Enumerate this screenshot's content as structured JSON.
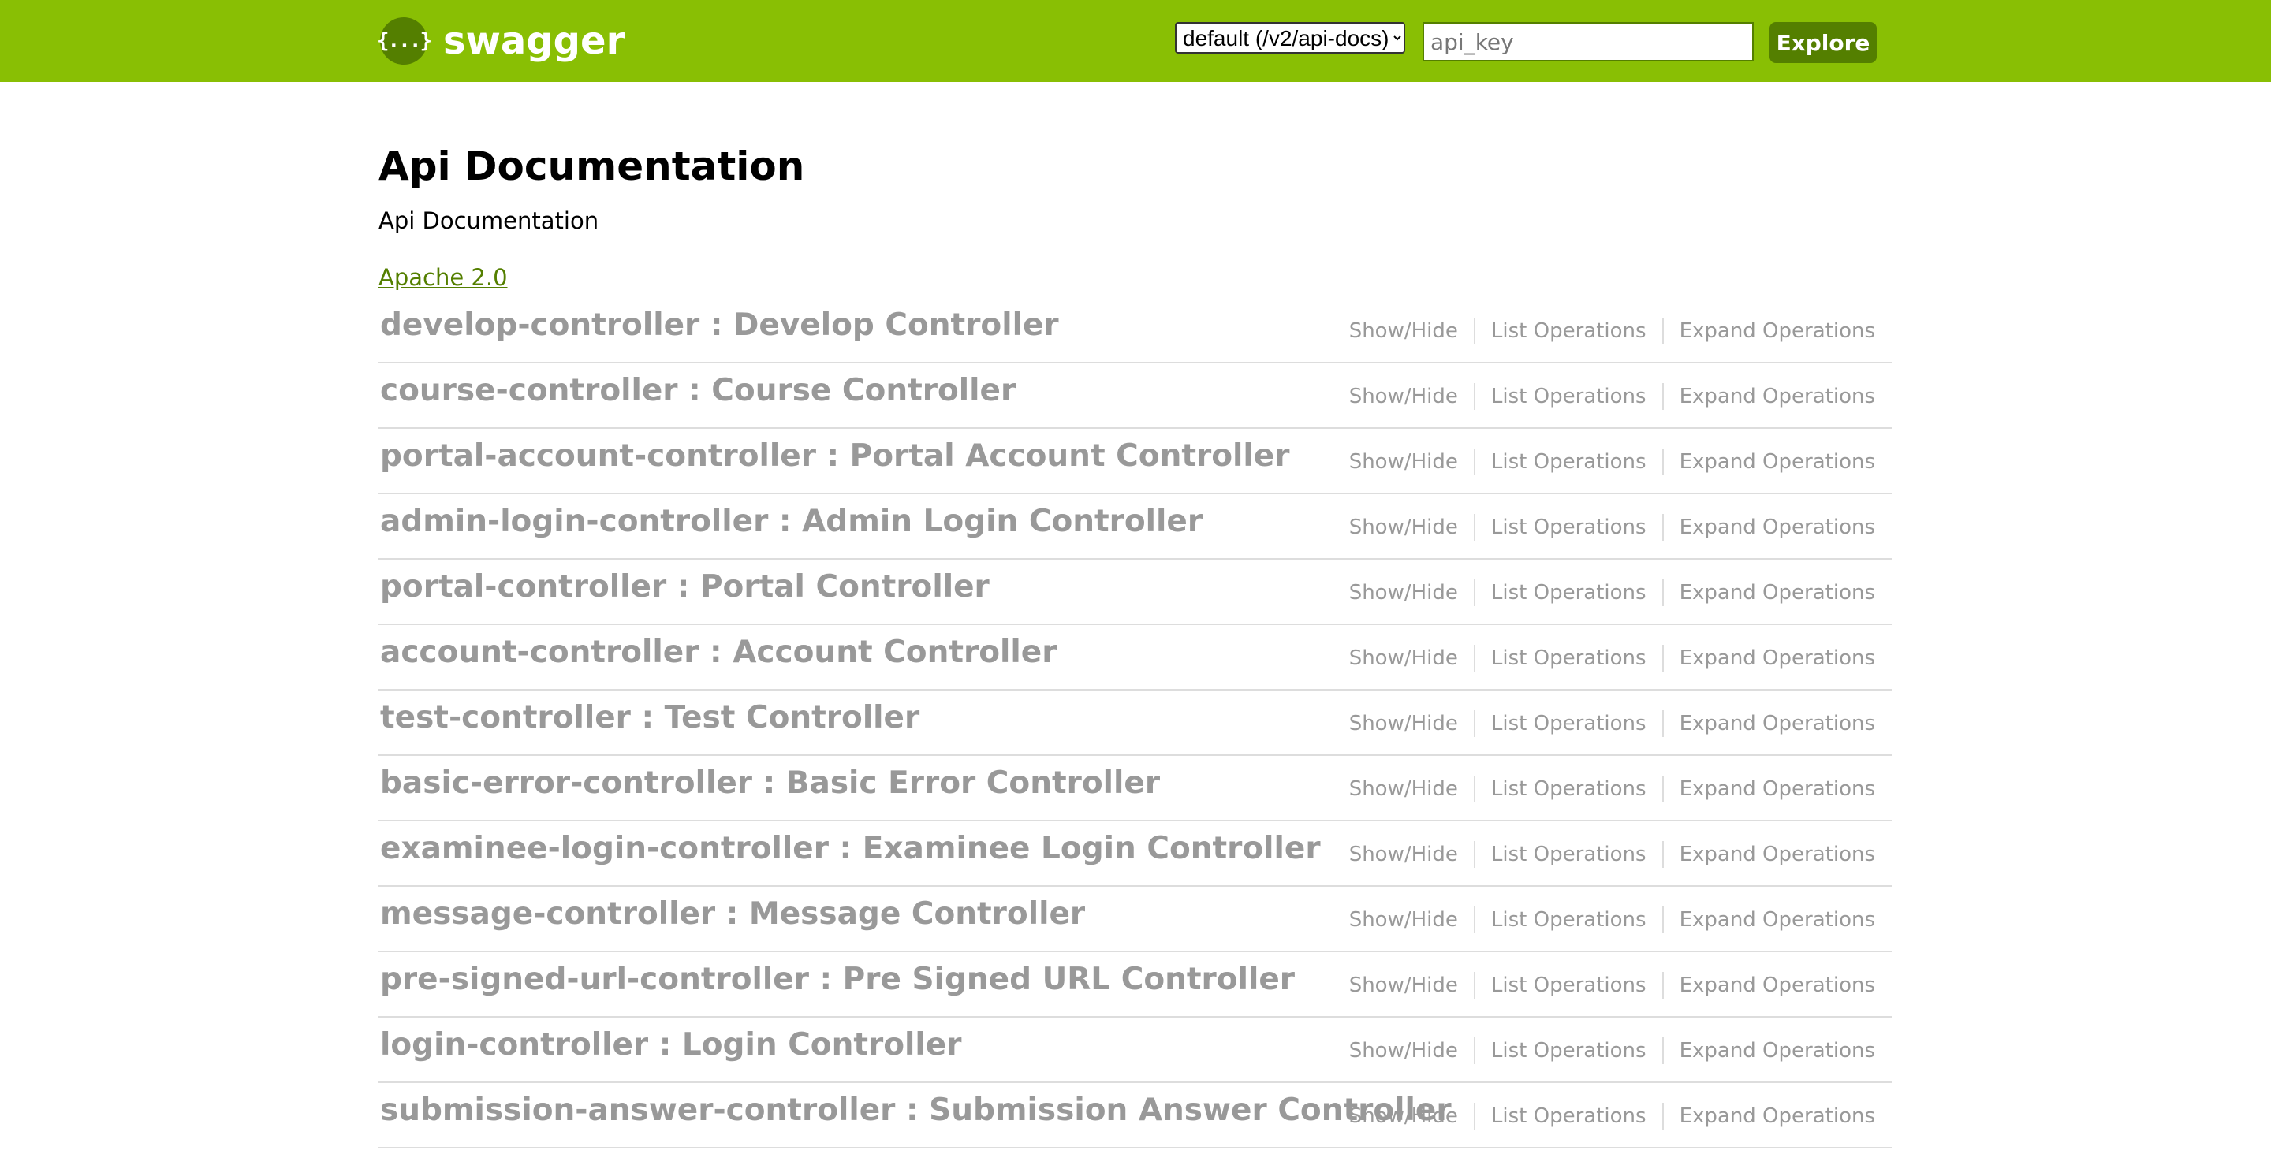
{
  "header": {
    "logo_text": "swagger",
    "logo_glyph": "{...}",
    "spec_selected": "default (/v2/api-docs)",
    "api_key_placeholder": "api_key",
    "explore_label": "Explore",
    "colors": {
      "bar": "#89bf04",
      "dark": "#547f00"
    }
  },
  "info": {
    "title": "Api Documentation",
    "description": "Api Documentation",
    "license": "Apache 2.0"
  },
  "op_labels": {
    "show_hide": "Show/Hide",
    "list": "List Operations",
    "expand": "Expand Operations"
  },
  "resources": [
    "develop-controller : Develop Controller",
    "course-controller : Course Controller",
    "portal-account-controller : Portal Account Controller",
    "admin-login-controller : Admin Login Controller",
    "portal-controller : Portal Controller",
    "account-controller : Account Controller",
    "test-controller : Test Controller",
    "basic-error-controller : Basic Error Controller",
    "examinee-login-controller : Examinee Login Controller",
    "message-controller : Message Controller",
    "pre-signed-url-controller : Pre Signed URL Controller",
    "login-controller : Login Controller",
    "submission-answer-controller : Submission Answer Controller"
  ]
}
